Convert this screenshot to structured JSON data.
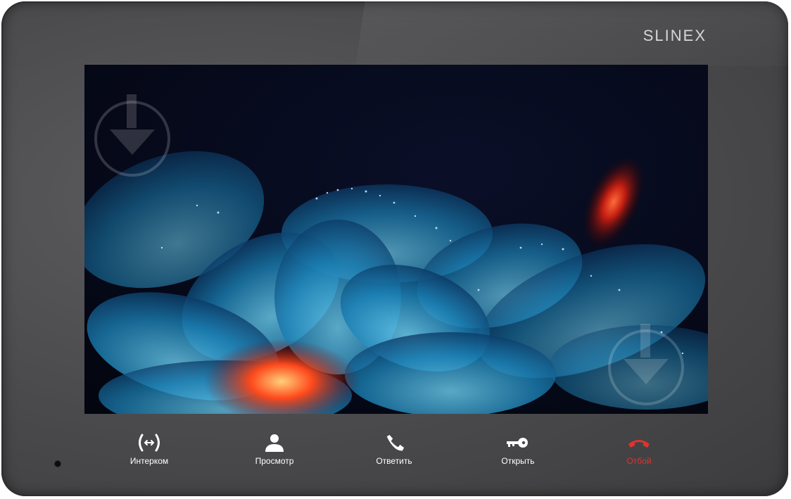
{
  "device": {
    "brand": "SLINEX",
    "colors": {
      "body": "#4a4a4c",
      "screen_bg": "#050a1e",
      "text": "#ffffff",
      "hangup": "#e0322d"
    }
  },
  "screen": {
    "content": "wallpaper"
  },
  "controls": [
    {
      "id": "intercom",
      "label": "Интерком",
      "icon": "intercom-icon"
    },
    {
      "id": "monitor",
      "label": "Просмотр",
      "icon": "person-icon"
    },
    {
      "id": "answer",
      "label": "Ответить",
      "icon": "handset-icon"
    },
    {
      "id": "unlock",
      "label": "Открыть",
      "icon": "key-icon"
    },
    {
      "id": "hangup",
      "label": "Отбой",
      "icon": "hangup-icon"
    }
  ]
}
